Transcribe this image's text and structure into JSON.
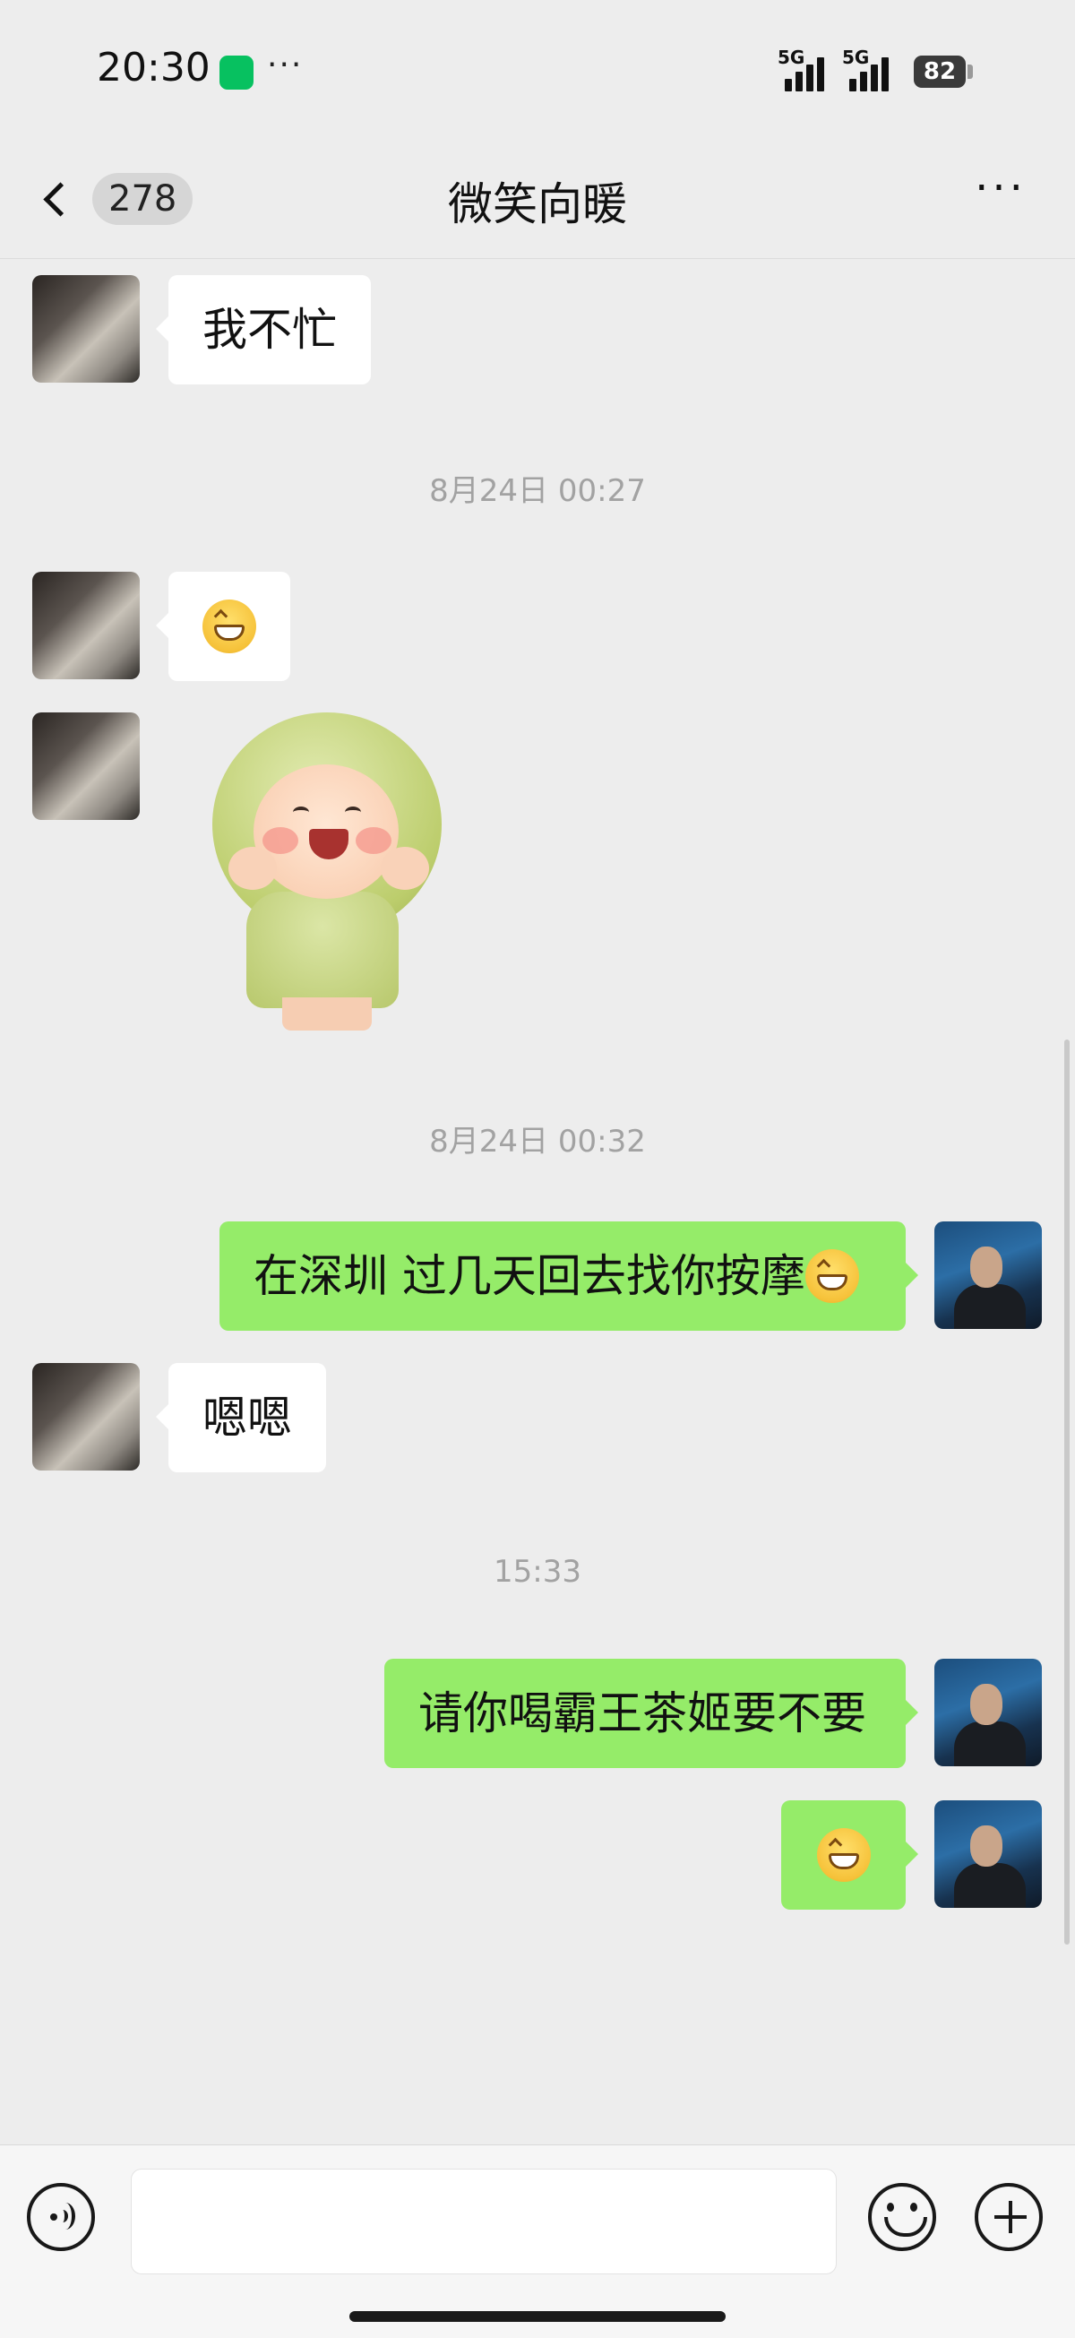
{
  "status_bar": {
    "time": "20:30",
    "signal1": "5G",
    "signal2": "5G",
    "battery": "82",
    "overflow": "···"
  },
  "nav": {
    "back_count": "278",
    "title": "微笑向暖",
    "more": "···"
  },
  "messages": {
    "m1": {
      "sender": "contact",
      "text": "我不忙"
    },
    "ts1": "8月24日 00:27",
    "m2": {
      "sender": "contact",
      "emoji": "grin-emoji"
    },
    "m3": {
      "sender": "contact",
      "sticker": "smiling-baby-sticker"
    },
    "ts2": "8月24日 00:32",
    "m4": {
      "sender": "me",
      "text": "在深圳 过几天回去找你按摩",
      "emoji": "grin-emoji"
    },
    "m5": {
      "sender": "contact",
      "text": "嗯嗯"
    },
    "ts3": "15:33",
    "m6": {
      "sender": "me",
      "text": "请你喝霸王茶姬要不要"
    },
    "m7": {
      "sender": "me",
      "emoji": "grin-emoji"
    }
  },
  "input": {
    "placeholder": "",
    "value": ""
  },
  "icons": {
    "voice": "voice-icon",
    "emoji": "emoji-icon",
    "plus": "plus-icon"
  },
  "colors": {
    "outgoing_bubble": "#95ec69",
    "incoming_bubble": "#ffffff",
    "background": "#ededed",
    "timestamp": "#a2a2a2"
  }
}
